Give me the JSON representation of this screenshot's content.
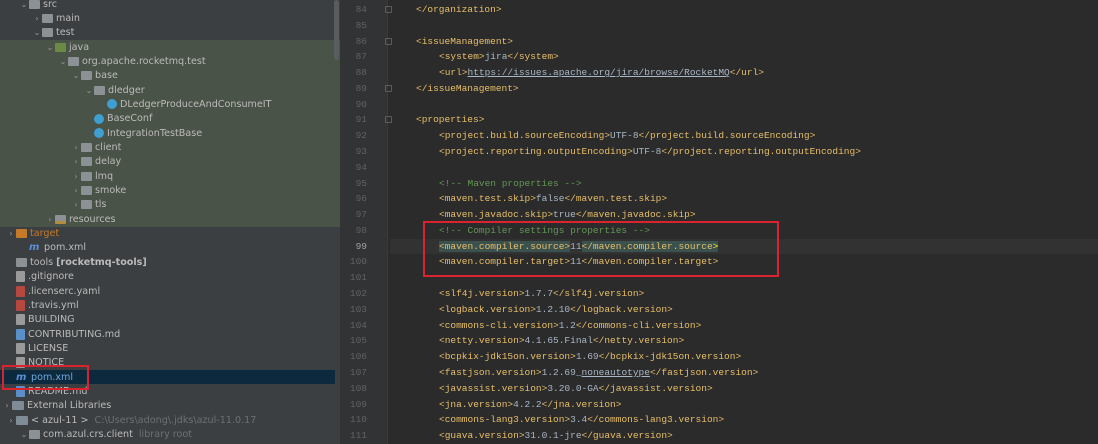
{
  "project_tree": [
    {
      "label": "src",
      "depth": 0,
      "open": true,
      "icon": "folder"
    },
    {
      "label": "main",
      "depth": 1,
      "open": false,
      "icon": "folder"
    },
    {
      "label": "test",
      "depth": 1,
      "open": true,
      "icon": "folder"
    },
    {
      "label": "java",
      "depth": 2,
      "open": true,
      "icon": "src"
    },
    {
      "label": "org.apache.rocketmq.test",
      "depth": 3,
      "open": true,
      "icon": "pkg"
    },
    {
      "label": "base",
      "depth": 4,
      "open": true,
      "icon": "pkg"
    },
    {
      "label": "dledger",
      "depth": 5,
      "open": true,
      "icon": "pkg"
    },
    {
      "label": "DLedgerProduceAndConsumeIT",
      "depth": 6,
      "icon": "cls"
    },
    {
      "label": "BaseConf",
      "depth": 5,
      "icon": "cls"
    },
    {
      "label": "IntegrationTestBase",
      "depth": 5,
      "icon": "cls"
    },
    {
      "label": "client",
      "depth": 4,
      "open": false,
      "icon": "pkg"
    },
    {
      "label": "delay",
      "depth": 4,
      "open": false,
      "icon": "pkg"
    },
    {
      "label": "lmq",
      "depth": 4,
      "open": false,
      "icon": "pkg"
    },
    {
      "label": "smoke",
      "depth": 4,
      "open": false,
      "icon": "pkg"
    },
    {
      "label": "tls",
      "depth": 4,
      "open": false,
      "icon": "pkg"
    },
    {
      "label": "resources",
      "depth": 2,
      "open": false,
      "icon": "res"
    },
    {
      "label": "target",
      "depth": -1,
      "open": false,
      "icon": "target"
    },
    {
      "label": "pom.xml",
      "depth": 0,
      "icon": "mvn"
    },
    {
      "label": "tools",
      "bold_suffix": "[rocketmq-tools]",
      "depth": -1,
      "icon": "folder"
    },
    {
      "label": ".gitignore",
      "depth": -1,
      "icon": "file"
    },
    {
      "label": ".licenserc.yaml",
      "depth": -1,
      "icon": "yml"
    },
    {
      "label": ".travis.yml",
      "depth": -1,
      "icon": "yml"
    },
    {
      "label": "BUILDING",
      "depth": -1,
      "icon": "file"
    },
    {
      "label": "CONTRIBUTING.md",
      "depth": -1,
      "icon": "md"
    },
    {
      "label": "LICENSE",
      "depth": -1,
      "icon": "file"
    },
    {
      "label": "NOTICE",
      "depth": -1,
      "icon": "file"
    },
    {
      "label": "pom.xml",
      "depth": -1,
      "icon": "mvn",
      "selected": true
    },
    {
      "label": "README.md",
      "depth": -1,
      "icon": "md"
    },
    {
      "label": "External Libraries",
      "depth": -2,
      "open": false,
      "icon": "lib"
    },
    {
      "label": "< azul-11 >",
      "muted_suffix": "C:\\Users\\adong\\.jdks\\azul-11.0.17",
      "depth": -1,
      "open": false,
      "icon": "lib"
    },
    {
      "label": "com.azul.crs.client",
      "muted_suffix": "library root",
      "depth": 0,
      "open": true,
      "icon": "folder"
    }
  ],
  "editor": {
    "current_line": 99,
    "lines": [
      {
        "n": 84,
        "fold": true,
        "ind": 1,
        "t": [
          [
            "tag",
            "</organization>"
          ]
        ]
      },
      {
        "n": 85,
        "ind": 0,
        "t": []
      },
      {
        "n": 86,
        "fold": true,
        "ind": 1,
        "t": [
          [
            "tag",
            "<issueManagement>"
          ]
        ]
      },
      {
        "n": 87,
        "ind": 2,
        "t": [
          [
            "tag",
            "<system>"
          ],
          [
            "txt",
            "jira"
          ],
          [
            "tag",
            "</system>"
          ]
        ]
      },
      {
        "n": 88,
        "ind": 2,
        "t": [
          [
            "tag",
            "<url>"
          ],
          [
            "url",
            "https://issues.apache.org/jira/browse/RocketMQ"
          ],
          [
            "tag",
            "</url>"
          ]
        ]
      },
      {
        "n": 89,
        "fold": true,
        "ind": 1,
        "t": [
          [
            "tag",
            "</issueManagement>"
          ]
        ]
      },
      {
        "n": 90,
        "ind": 0,
        "t": []
      },
      {
        "n": 91,
        "fold": true,
        "ind": 1,
        "t": [
          [
            "tag",
            "<properties>"
          ]
        ]
      },
      {
        "n": 92,
        "ind": 2,
        "t": [
          [
            "tag",
            "<project.build.sourceEncoding>"
          ],
          [
            "txt",
            "UTF-8"
          ],
          [
            "tag",
            "</project.build.sourceEncoding>"
          ]
        ]
      },
      {
        "n": 93,
        "ind": 2,
        "t": [
          [
            "tag",
            "<project.reporting.outputEncoding>"
          ],
          [
            "txt",
            "UTF-8"
          ],
          [
            "tag",
            "</project.reporting.outputEncoding>"
          ]
        ]
      },
      {
        "n": 94,
        "ind": 0,
        "t": []
      },
      {
        "n": 95,
        "ind": 2,
        "t": [
          [
            "cmt",
            "<!-- Maven properties -->"
          ]
        ]
      },
      {
        "n": 96,
        "ind": 2,
        "t": [
          [
            "tag",
            "<maven.test.skip>"
          ],
          [
            "txt",
            "false"
          ],
          [
            "tag",
            "</maven.test.skip>"
          ]
        ]
      },
      {
        "n": 97,
        "ind": 2,
        "t": [
          [
            "tag",
            "<maven.javadoc.skip>"
          ],
          [
            "txt",
            "true"
          ],
          [
            "tag",
            "</maven.javadoc.skip>"
          ]
        ]
      },
      {
        "n": 98,
        "ind": 2,
        "t": [
          [
            "cmt",
            "<!-- Compiler settings properties -->"
          ]
        ]
      },
      {
        "n": 99,
        "ind": 2,
        "t": [
          [
            "hl",
            "<maven.compiler.source>"
          ],
          [
            "txt",
            "11"
          ],
          [
            "hl",
            "</maven.compiler.source"
          ],
          [
            "hlb",
            ">"
          ]
        ]
      },
      {
        "n": 100,
        "ind": 2,
        "t": [
          [
            "tag",
            "<maven.compiler.target>"
          ],
          [
            "txt",
            "11"
          ],
          [
            "tag",
            "</maven.compiler.target>"
          ]
        ]
      },
      {
        "n": 101,
        "ind": 0,
        "t": []
      },
      {
        "n": 102,
        "ind": 2,
        "t": [
          [
            "tag",
            "<slf4j.version>"
          ],
          [
            "txt",
            "1.7.7"
          ],
          [
            "tag",
            "</slf4j.version>"
          ]
        ]
      },
      {
        "n": 103,
        "ind": 2,
        "t": [
          [
            "tag",
            "<logback.version>"
          ],
          [
            "txt",
            "1.2.10"
          ],
          [
            "tag",
            "</logback.version>"
          ]
        ]
      },
      {
        "n": 104,
        "ind": 2,
        "t": [
          [
            "tag",
            "<commons-cli.version>"
          ],
          [
            "txt",
            "1.2"
          ],
          [
            "tag",
            "</commons-cli.version>"
          ]
        ]
      },
      {
        "n": 105,
        "ind": 2,
        "t": [
          [
            "tag",
            "<netty.version>"
          ],
          [
            "txt",
            "4.1.65.Final"
          ],
          [
            "tag",
            "</netty.version>"
          ]
        ]
      },
      {
        "n": 106,
        "ind": 2,
        "t": [
          [
            "tag",
            "<bcpkix-jdk15on.version>"
          ],
          [
            "txt",
            "1.69"
          ],
          [
            "tag",
            "</bcpkix-jdk15on.version>"
          ]
        ]
      },
      {
        "n": 107,
        "ind": 2,
        "t": [
          [
            "tag",
            "<fastjson.version>"
          ],
          [
            "txt",
            "1.2.69_"
          ],
          [
            "url",
            "noneautotype"
          ],
          [
            "tag",
            "</fastjson.version>"
          ]
        ]
      },
      {
        "n": 108,
        "ind": 2,
        "t": [
          [
            "tag",
            "<javassist.version>"
          ],
          [
            "txt",
            "3.20.0-GA"
          ],
          [
            "tag",
            "</javassist.version>"
          ]
        ]
      },
      {
        "n": 109,
        "ind": 2,
        "t": [
          [
            "tag",
            "<jna.version>"
          ],
          [
            "txt",
            "4.2.2"
          ],
          [
            "tag",
            "</jna.version>"
          ]
        ]
      },
      {
        "n": 110,
        "ind": 2,
        "t": [
          [
            "tag",
            "<commons-lang3.version>"
          ],
          [
            "txt",
            "3.4"
          ],
          [
            "tag",
            "</commons-lang3.version>"
          ]
        ]
      },
      {
        "n": 111,
        "ind": 2,
        "t": [
          [
            "tag",
            "<guava.version>"
          ],
          [
            "txt",
            "31.0.1-jre"
          ],
          [
            "tag",
            "</guava.version>"
          ]
        ]
      }
    ]
  },
  "colors": {
    "highlight_box": "#d9232e",
    "selection": "#0d293e"
  }
}
